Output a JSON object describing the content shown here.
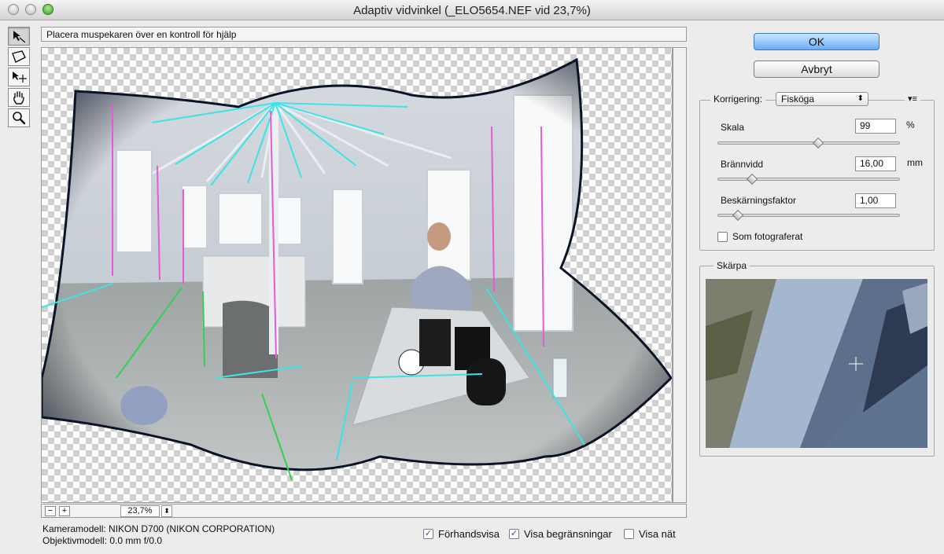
{
  "window": {
    "title": "Adaptiv vidvinkel (_ELO5654.NEF vid 23,7%)"
  },
  "tools": [
    {
      "icon": "constraint-tool-icon",
      "active": true
    },
    {
      "icon": "polygon-constraint-tool-icon",
      "active": false
    },
    {
      "icon": "move-tool-icon",
      "active": false
    },
    {
      "icon": "hand-tool-icon",
      "active": false
    },
    {
      "icon": "zoom-tool-icon",
      "active": false
    }
  ],
  "help": {
    "text": "Placera muspekaren över en kontroll för hjälp"
  },
  "zoom": {
    "value": "23,7%",
    "minus": "−",
    "plus": "+",
    "stepper": "⬍"
  },
  "info": {
    "camera": "Kameramodell: NIKON D700 (NIKON CORPORATION)",
    "lens": "Objektivmodell: 0.0 mm f/0.0"
  },
  "preview_options": [
    {
      "label": "Förhandsvisa",
      "checked": true
    },
    {
      "label": "Visa begränsningar",
      "checked": true
    },
    {
      "label": "Visa nät",
      "checked": false
    }
  ],
  "buttons": {
    "ok": "OK",
    "cancel": "Avbryt"
  },
  "correction": {
    "label": "Korrigering:",
    "selected": "Fiskö­ga",
    "menu_icon": "panel-menu-icon",
    "scale": {
      "label": "Skala",
      "value": "99",
      "unit": "%",
      "position": 0.55
    },
    "focal": {
      "label": "Brännvidd",
      "value": "16,00",
      "unit": "mm",
      "position": 0.19
    },
    "crop": {
      "label": "Beskärningsfaktor",
      "value": "1,00",
      "unit": "",
      "position": 0.11
    },
    "as_shot": {
      "label": "Som fotograferat",
      "checked": false
    }
  },
  "sharpness": {
    "label": "Skärpa"
  }
}
